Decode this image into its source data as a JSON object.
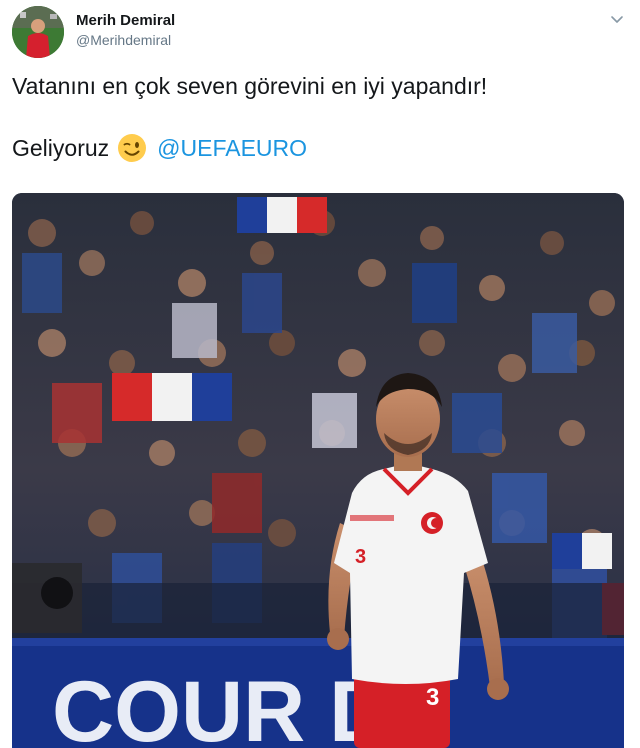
{
  "tweet": {
    "display_name": "Merih Demiral",
    "handle": "@Merihdemiral",
    "text_line1": "Vatanını en çok seven görevini en iyi yapandır!",
    "text_line2": "Geliyoruz",
    "emoji": "winking-face-emoji",
    "mention": "@UEFAEURO"
  },
  "media": {
    "board_text": "COUR DE",
    "jersey_number": "3"
  },
  "colors": {
    "link": "#1b95e0",
    "text": "#14171a",
    "secondary": "#657786"
  }
}
